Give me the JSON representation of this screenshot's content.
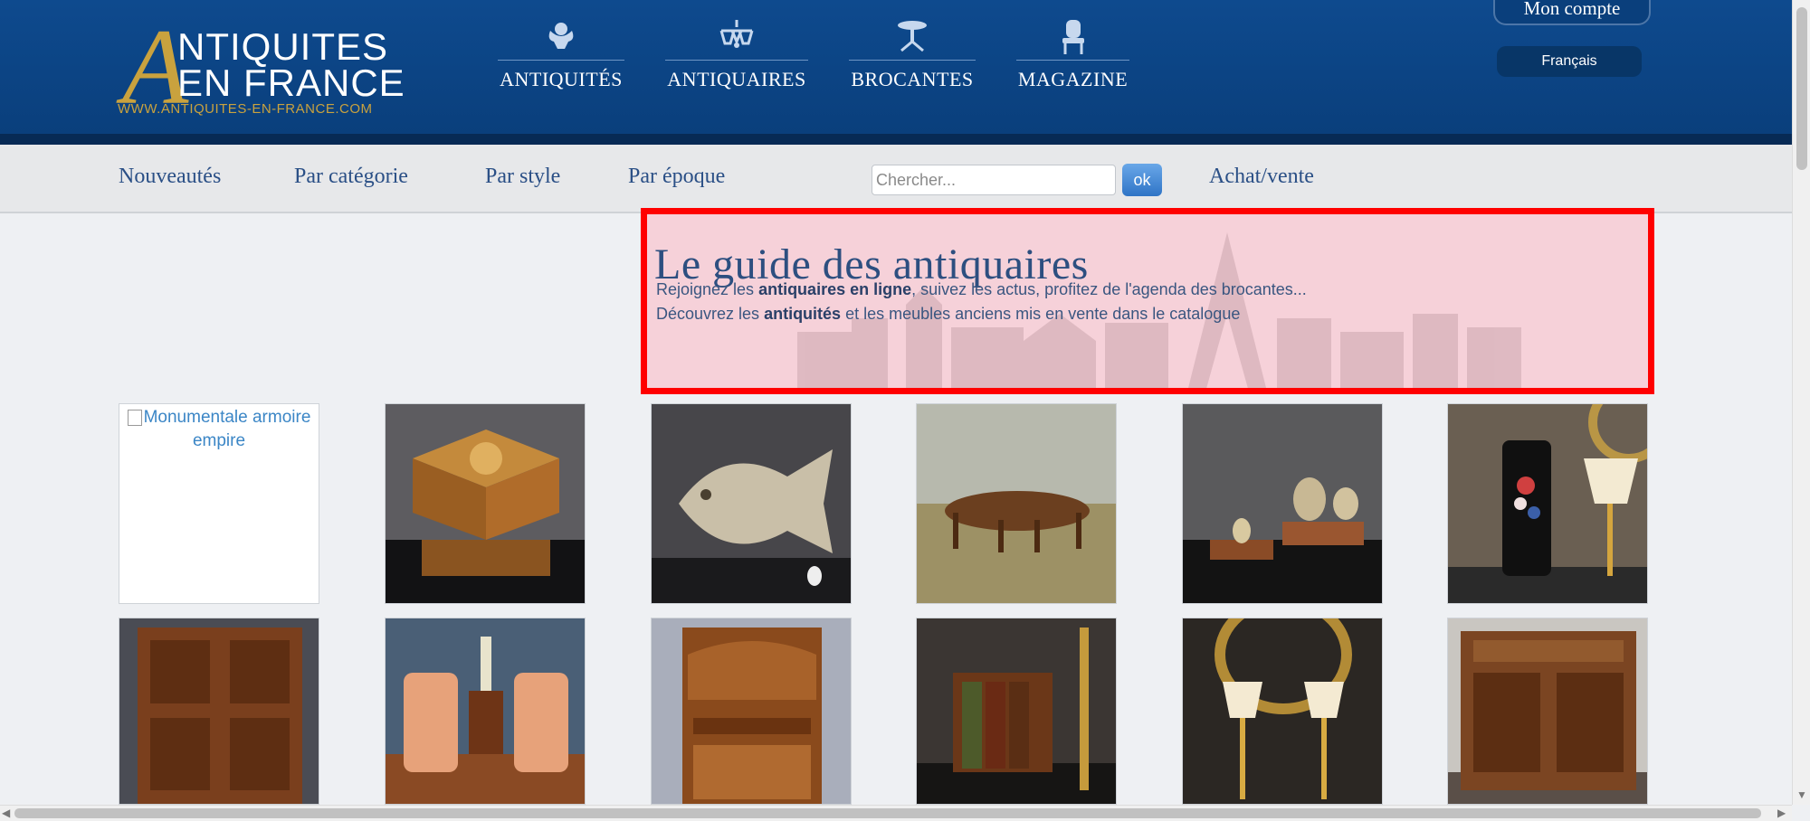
{
  "header": {
    "logo_line1": "NTIQUITES",
    "logo_line2": "EN FRANCE",
    "logo_initial": "A",
    "logo_url": "WWW.ANTIQUITES-EN-FRANCE.COM",
    "nav": [
      {
        "label": "ANTIQUITÉS",
        "icon": "cherub-icon"
      },
      {
        "label": "ANTIQUAIRES",
        "icon": "chandelier-icon"
      },
      {
        "label": "BROCANTES",
        "icon": "pedestal-table-icon"
      },
      {
        "label": "MAGAZINE",
        "icon": "chair-icon"
      }
    ],
    "account_label": "Mon compte",
    "language": "Français"
  },
  "subnav": {
    "links": [
      "Nouveautés",
      "Par catégorie",
      "Par style",
      "Par époque"
    ],
    "search_placeholder": "Chercher...",
    "search_button": "ok",
    "achat_label": "Achat/vente"
  },
  "hero": {
    "title": "Le guide des antiquaires",
    "line1_pre": "Rejoignez les ",
    "line1_bold": "antiquaires en ligne",
    "line1_post": ", suivez les actus, profitez de l'agenda des brocantes...",
    "line2_pre": "Découvrez les ",
    "line2_bold": "antiquités",
    "line2_post": " et les meubles anciens mis en vente dans le catalogue"
  },
  "products": [
    {
      "alt": "Monumentale armoire empire",
      "kind": "broken"
    },
    {
      "kind": "marquetry-box"
    },
    {
      "kind": "fish-sculpture"
    },
    {
      "kind": "round-table"
    },
    {
      "kind": "eggs-stand"
    },
    {
      "kind": "vase-lamp"
    },
    {
      "kind": "cabinet-dark"
    },
    {
      "kind": "two-chairs"
    },
    {
      "kind": "secretary-desk"
    },
    {
      "kind": "book-box"
    },
    {
      "kind": "lamps-pair"
    },
    {
      "kind": "carved-buffet"
    }
  ],
  "colors": {
    "header_bg": "#0e4a8e",
    "gold": "#c9a23e",
    "link_blue": "#2a4f86",
    "hero_border": "#ff0000"
  }
}
